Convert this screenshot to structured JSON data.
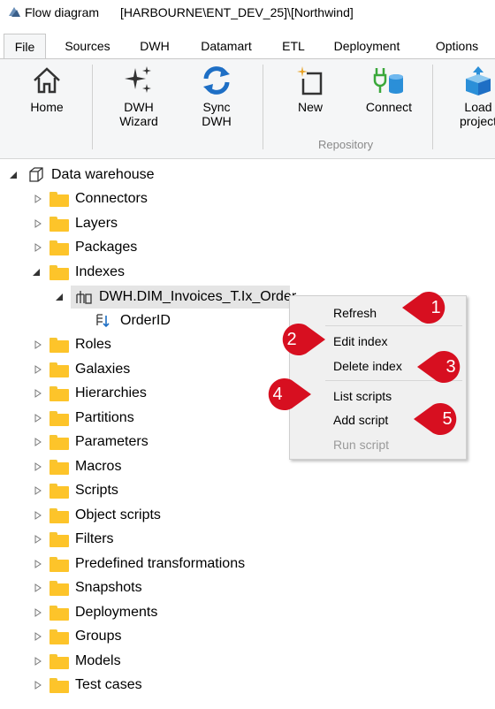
{
  "window": {
    "title": "Flow diagram",
    "context": "[HARBOURNE\\ENT_DEV_25]\\[Northwind]"
  },
  "ribbon": {
    "tabs": [
      "File",
      "Sources",
      "DWH",
      "Datamart",
      "ETL",
      "Deployment",
      "Options"
    ],
    "active_tab": "File",
    "buttons": {
      "home": "Home",
      "dwh_wizard_1": "DWH",
      "dwh_wizard_2": "Wizard",
      "sync_dwh_1": "Sync",
      "sync_dwh_2": "DWH",
      "new": "New",
      "connect": "Connect",
      "load_1": "Load",
      "load_2": "project"
    },
    "groups": {
      "repository": "Repository"
    }
  },
  "tree": {
    "root": "Data warehouse",
    "items": {
      "connectors": "Connectors",
      "layers": "Layers",
      "packages": "Packages",
      "indexes": "Indexes",
      "index_node": "DWH.DIM_Invoices_T.Ix_Order",
      "index_column": "OrderID",
      "roles": "Roles",
      "galaxies": "Galaxies",
      "hierarchies": "Hierarchies",
      "partitions": "Partitions",
      "parameters": "Parameters",
      "macros": "Macros",
      "scripts": "Scripts",
      "object_scripts": "Object scripts",
      "filters": "Filters",
      "predefined_transformations": "Predefined transformations",
      "snapshots": "Snapshots",
      "deployments": "Deployments",
      "groups": "Groups",
      "models": "Models",
      "test_cases": "Test cases"
    }
  },
  "context_menu": {
    "refresh": "Refresh",
    "edit_index": "Edit index",
    "delete_index": "Delete index",
    "list_scripts": "List scripts",
    "add_script": "Add script",
    "run_script": "Run script"
  },
  "callouts": [
    "1",
    "2",
    "3",
    "4",
    "5"
  ],
  "colors": {
    "accent_blue": "#1e6fc5",
    "callout_red": "#d70f20",
    "folder_yellow": "#fdc42a"
  }
}
